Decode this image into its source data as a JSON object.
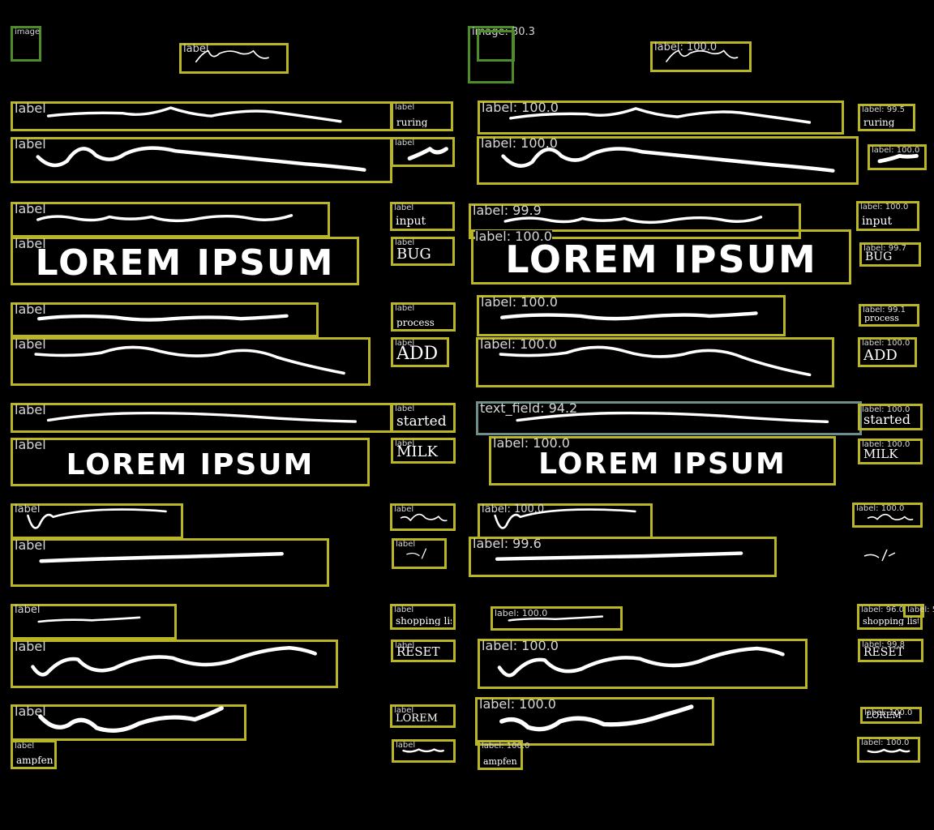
{
  "left": {
    "image_label": "image",
    "box_label": "label",
    "big_text_1": "LOREM IPSUM",
    "big_text_2": "LOREM  IPSUM",
    "mini_texts": [
      "ruring",
      "input",
      "BUG",
      "process",
      "ADD",
      "started",
      "MILK",
      "shopping list",
      "RESET",
      "LOREM",
      "ampfen"
    ]
  },
  "right": {
    "image_label": "image: 30.3",
    "scores": {
      "top_wave": "label: 100.0",
      "row1_a": "label: 100.0",
      "row1_b": "label: 99.5",
      "row2_a": "label: 100.0",
      "row2_b": "label: 100.0",
      "row3_a": "label: 99.9",
      "row3_b": "label: 100.0",
      "row4_a": "label: 100.0",
      "row4_b": "label: 99.7",
      "row5_a": "label: 100.0",
      "row5_b": "label: 99.1",
      "row6_a": "label: 100.0",
      "row6_b": "label: 100.0",
      "row7_a": "text_field: 94.2",
      "row7_b": "label: 100.0",
      "row8_a": "label: 100.0",
      "row8_b": "label: 100.0",
      "row9_a": "label: 100.0",
      "row9_b": "label: 100.0",
      "row10_a": "label: 99.6",
      "row11_a": "label: 100.0",
      "row11_b": "label: 96.0",
      "row11_c": "label: 55",
      "row12_a": "label: 100.0",
      "row12_b": "label: 99.8",
      "row13_a": "label: 100.0",
      "row13_b": "label: 100.0",
      "row14_a": "label: 100.0",
      "row14_b": "label: 100.0"
    },
    "big_text_1": "LOREM IPSUM",
    "big_text_2": "LOREM  IPSUM"
  },
  "colors": {
    "background": "#000000",
    "label_box": "#b9b524",
    "image_box": "#4e8c2a",
    "text_field_box": "#6c8f8a"
  }
}
